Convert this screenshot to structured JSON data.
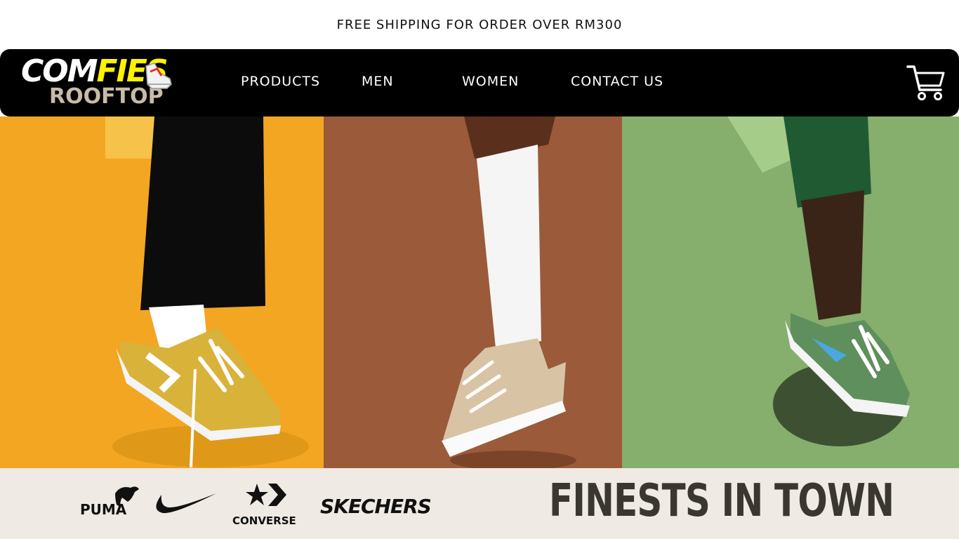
{
  "announcement": "FREE SHIPPING FOR ORDER OVER RM300",
  "logo": {
    "line1_part1": "COM",
    "line1_part2": "FIES",
    "line2": "ROOFTOP"
  },
  "nav": {
    "items": [
      {
        "label": "PRODUCTS"
      },
      {
        "label": "MEN"
      },
      {
        "label": "WOMEN"
      },
      {
        "label": "CONTACT US"
      }
    ],
    "cart_icon": "shopping-cart-icon"
  },
  "hero": {
    "panels": [
      {
        "background": "#f3a622",
        "shoe_color": "#d9b23a",
        "pants_color": "#0c0c0c"
      },
      {
        "background": "#9b5a3a",
        "shoe_color": "#d8c4a4",
        "pants_color": "#ffffff"
      },
      {
        "background": "#86ae6c",
        "shoe_color": "#5f8f5c",
        "pants_color": "#1f5a33"
      }
    ]
  },
  "brands": {
    "items": [
      {
        "label": "PUMA",
        "icon": "puma-logo-icon"
      },
      {
        "label": "",
        "icon": "nike-swoosh-icon"
      },
      {
        "label": "CONVERSE",
        "icon": "converse-star-icon"
      },
      {
        "label": "SKECHERS",
        "icon": "skechers-logo-icon"
      }
    ],
    "tagline": "FINESTS IN TOWN"
  },
  "colors": {
    "navbar": "#000000",
    "logo_accent": "#fff200",
    "logo_sub": "#c8bba8",
    "brand_bar": "#efeae3",
    "tagline": "#3a3630"
  }
}
